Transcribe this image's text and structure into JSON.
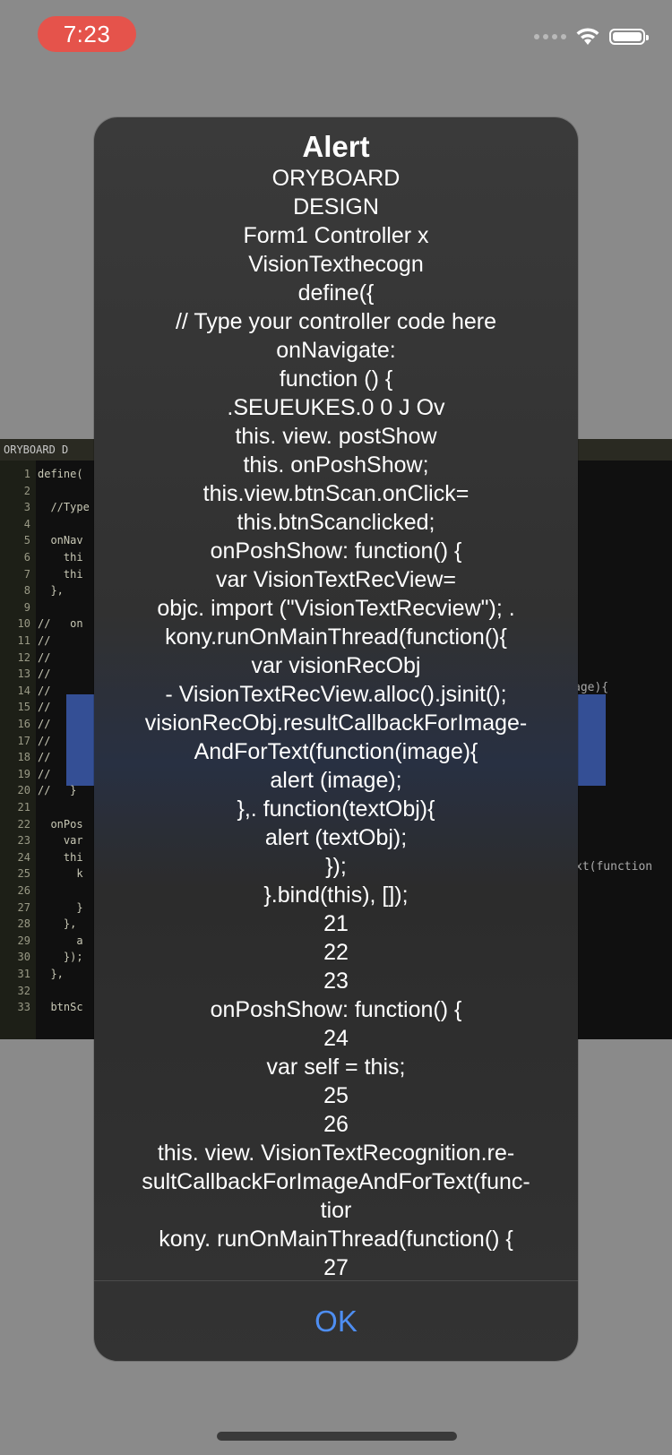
{
  "status_bar": {
    "time": "7:23"
  },
  "background_code": {
    "tab": "ORYBOARD   D",
    "lines": [
      {
        "n": "1",
        "t": "define("
      },
      {
        "n": "2",
        "t": ""
      },
      {
        "n": "3",
        "t": "  //Type"
      },
      {
        "n": "4",
        "t": ""
      },
      {
        "n": "5",
        "t": "  onNav"
      },
      {
        "n": "6",
        "t": "    thi"
      },
      {
        "n": "7",
        "t": "    thi"
      },
      {
        "n": "8",
        "t": "  },"
      },
      {
        "n": "9",
        "t": ""
      },
      {
        "n": "10",
        "t": "//   on"
      },
      {
        "n": "11",
        "t": "//"
      },
      {
        "n": "12",
        "t": "//"
      },
      {
        "n": "13",
        "t": "//"
      },
      {
        "n": "14",
        "t": "//"
      },
      {
        "n": "15",
        "t": "//"
      },
      {
        "n": "16",
        "t": "//"
      },
      {
        "n": "17",
        "t": "//"
      },
      {
        "n": "18",
        "t": "//"
      },
      {
        "n": "19",
        "t": "//"
      },
      {
        "n": "20",
        "t": "//   }"
      },
      {
        "n": "21",
        "t": ""
      },
      {
        "n": "22",
        "t": "  onPos"
      },
      {
        "n": "23",
        "t": "    var"
      },
      {
        "n": "24",
        "t": "    thi"
      },
      {
        "n": "25",
        "t": "      k"
      },
      {
        "n": "26",
        "t": ""
      },
      {
        "n": "27",
        "t": "      }"
      },
      {
        "n": "28",
        "t": "    },"
      },
      {
        "n": "29",
        "t": "      a"
      },
      {
        "n": "30",
        "t": "    });"
      },
      {
        "n": "31",
        "t": "  },"
      },
      {
        "n": "32",
        "t": ""
      },
      {
        "n": "33",
        "t": "  btnSc"
      }
    ],
    "right_snippet_1": "age){",
    "right_snippet_2": "xt(function"
  },
  "alert": {
    "title": "Alert",
    "message_lines": [
      "ORYBOARD",
      "DESIGN",
      "Form1 Controller x",
      "VisionTexthecogn",
      "define({",
      "// Type your controller code here",
      "onNavigate:",
      "function () {",
      ".SEUEUKES.0 0 J Ov",
      "this. view. postShow",
      "this. onPoshShow;",
      "this.view.btnScan.onClick=",
      "this.btnScanclicked;",
      "onPoshShow: function() {",
      "var VisionTextRecView=",
      "objc. import (\"VisionTextRecview\"); .",
      "kony.runOnMainThread(function(){",
      "var visionRecObj",
      "- VisionTextRecView.alloc().jsinit();",
      "visionRecObj.resultCallbackForImage-",
      "AndForText(function(image){",
      "alert (image);",
      "},. function(textObj){",
      "alert (textObj);",
      "});",
      "}.bind(this), []);",
      "21",
      "22",
      "23",
      "onPoshShow: function() {",
      "24",
      "var self = this;",
      "25",
      "26",
      "this. view. VisionTextRecognition.re-",
      "sultCallbackForImageAndForText(func-",
      "tior",
      "kony. runOnMainThread(function() {",
      "27"
    ],
    "ok_label": "OK"
  }
}
